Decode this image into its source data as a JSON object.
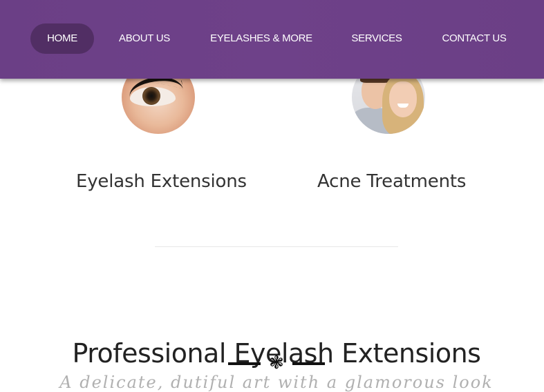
{
  "nav": {
    "items": [
      {
        "label": "HOME",
        "active": true
      },
      {
        "label": "ABOUT US",
        "active": false
      },
      {
        "label": "EYELASHES & MORE",
        "active": false
      },
      {
        "label": "SERVICES",
        "active": false
      },
      {
        "label": "CONTACT US",
        "active": false
      }
    ],
    "colors": {
      "bar": "#6b3f86",
      "active_pill": "#512e64"
    }
  },
  "services": [
    {
      "title": "Eyelash Extensions",
      "image": "eye-closeup-photo"
    },
    {
      "title": "Acne Treatments",
      "image": "smiling-couple-photo"
    }
  ],
  "section": {
    "heading": "Professional Eyelash Extensions",
    "ornament_icon": "flower-ornament-icon",
    "subtitle_partial": "A delicate, dutiful art with a glamorous look"
  }
}
